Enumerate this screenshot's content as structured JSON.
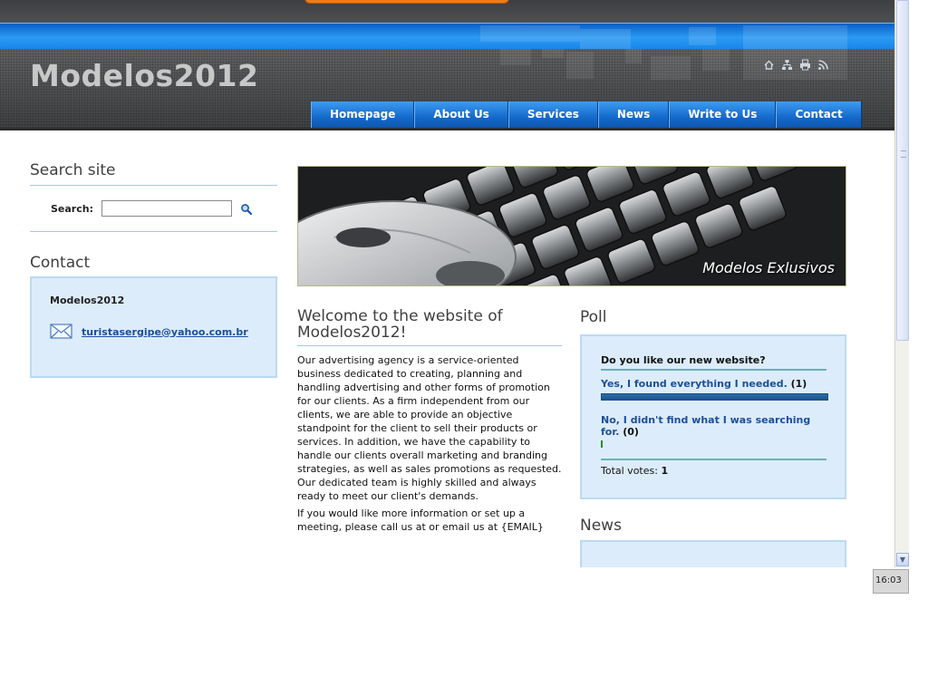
{
  "header": {
    "site_title": "Modelos2012",
    "icons": [
      "home-icon",
      "sitemap-icon",
      "print-icon",
      "rss-icon"
    ]
  },
  "nav": {
    "items": [
      {
        "label": "Homepage"
      },
      {
        "label": "About Us"
      },
      {
        "label": "Services"
      },
      {
        "label": "News"
      },
      {
        "label": "Write to Us"
      },
      {
        "label": "Contact"
      }
    ]
  },
  "search": {
    "title": "Search site",
    "label": "Search:",
    "value": "",
    "button_icon": "magnifier-icon"
  },
  "contact": {
    "title": "Contact",
    "name": "Modelos2012",
    "email": "turistasergipe@yahoo.com.br",
    "email_icon": "envelope-icon"
  },
  "banner": {
    "caption": "Modelos Exlusivos"
  },
  "welcome": {
    "title": "Welcome to the website of Modelos2012!",
    "paragraphs": [
      "Our advertising agency is a service-oriented business dedicated to creating, planning and handling advertising and other forms of promotion for our clients. As a firm independent from our clients, we are able to provide an objective standpoint for the client to sell their products or services. In addition, we have the capability to handle our clients overall marketing and branding strategies, as well as sales promotions as requested. Our dedicated team is highly skilled and always ready to meet our client's demands.",
      "If you would like more information or set up a meeting, please call us at or email us at {EMAIL}"
    ]
  },
  "poll": {
    "title": "Poll",
    "question": "Do you like our new website?",
    "options": [
      {
        "label": "Yes, I found everything I needed.",
        "count": "(1)",
        "fraction": 1.0
      },
      {
        "label": "No, I didn't find what I was searching for.",
        "count": "(0)",
        "fraction": 0.0
      }
    ],
    "total_label": "Total votes:",
    "total_value": "1"
  },
  "news": {
    "title": "News"
  },
  "taskbar": {
    "clock": "16:03"
  },
  "colors": {
    "nav_blue": "#1468c9",
    "panel_bg": "#dcecfb",
    "link_blue": "#1c4f9c"
  }
}
